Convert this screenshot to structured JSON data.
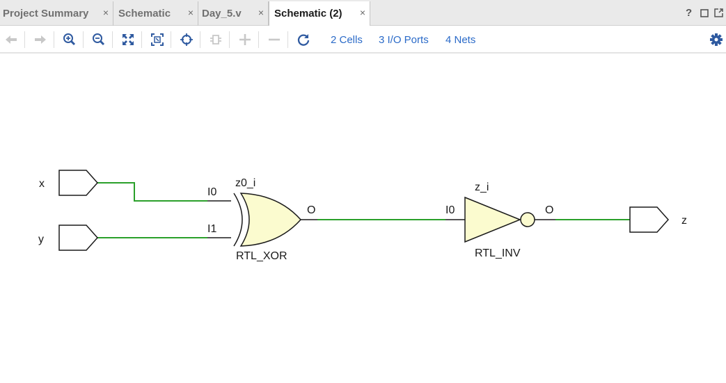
{
  "tabs": [
    {
      "label": "Project Summary",
      "close": "×",
      "active": false
    },
    {
      "label": "Schematic",
      "close": "×",
      "active": false
    },
    {
      "label": "Day_5.v",
      "close": "×",
      "active": false
    },
    {
      "label": "Schematic (2)",
      "close": "×",
      "active": true
    }
  ],
  "window_controls": {
    "help": "?",
    "restore": "☐",
    "float": "⧉"
  },
  "toolbar": {
    "icons": [
      "back-arrow-icon",
      "forward-arrow-icon",
      "zoom-in-icon",
      "zoom-out-icon",
      "fit-view-icon",
      "zoom-fit-selection-icon",
      "autofit-target-icon",
      "expand-cell-icon",
      "add-icon",
      "remove-icon",
      "refresh-icon",
      "settings-gear-icon"
    ],
    "cells_label": "2 Cells",
    "ports_label": "3 I/O Ports",
    "nets_label": "4 Nets"
  },
  "schematic": {
    "inputs": [
      {
        "name": "x"
      },
      {
        "name": "y"
      }
    ],
    "outputs": [
      {
        "name": "z"
      }
    ],
    "xor_cell": {
      "instance": "z0_i",
      "type": "RTL_XOR",
      "pin_i0": "I0",
      "pin_i1": "I1",
      "pin_o": "O"
    },
    "inv_cell": {
      "instance": "z_i",
      "type": "RTL_INV",
      "pin_i0": "I0",
      "pin_o": "O"
    },
    "colors": {
      "net": "#2aa02a",
      "cell_fill": "#fbfbcf",
      "stroke": "#1a1a1a"
    }
  }
}
